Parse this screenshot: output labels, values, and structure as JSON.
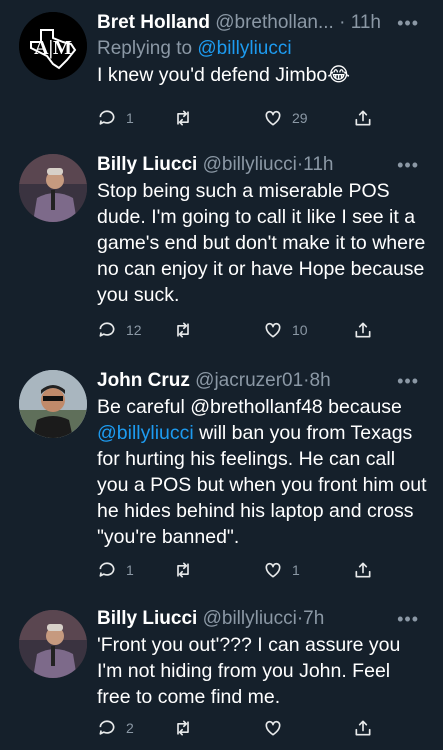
{
  "tweets": [
    {
      "name": "Bret Holland",
      "handle": "@brethollan...",
      "sep": "·",
      "time": "11h",
      "replying_prefix": "Replying to ",
      "replying_to": "@billyliucci",
      "text": "I knew you'd defend Jimbo",
      "emoji": "😂",
      "replies": "1",
      "retweets": "",
      "likes": "29",
      "avatar_logo": "A|M",
      "avatar_colors": {
        "bg": "#000000",
        "fg": "#ffffff"
      }
    },
    {
      "name": "Billy Liucci",
      "handle": "@billyliucci",
      "sep": "·",
      "time": "11h",
      "text": "Stop being such a miserable POS dude. I'm going to call it like I see it a game's end but don't make it to where no can enjoy it or have Hope because you suck.",
      "replies": "12",
      "retweets": "",
      "likes": "10"
    },
    {
      "name": "John Cruz",
      "handle": "@jacruzer01",
      "sep": "·",
      "time": "8h",
      "text_parts": [
        "Be careful @brethollanf48 because ",
        "@billyliucci",
        " will ban you from Texags for hurting his feelings. He can call you a POS but when you front him out he hides behind his laptop and cross \"you're banned\"."
      ],
      "replies": "1",
      "retweets": "",
      "likes": "1"
    },
    {
      "name": "Billy Liucci",
      "handle": "@billyliucci",
      "sep": "·",
      "time": "7h",
      "text": "'Front you out'??? I can assure you I'm not hiding from you John. Feel free to come find me.",
      "replies": "2",
      "retweets": "",
      "likes": ""
    }
  ],
  "icons": {
    "more": "more-icon",
    "reply": "reply-icon",
    "retweet": "retweet-icon",
    "like": "like-icon",
    "share": "share-icon"
  },
  "colors": {
    "background": "#15202b",
    "secondary_text": "#8b98a5",
    "link": "#1d9bf0",
    "divider": "#38444d"
  }
}
